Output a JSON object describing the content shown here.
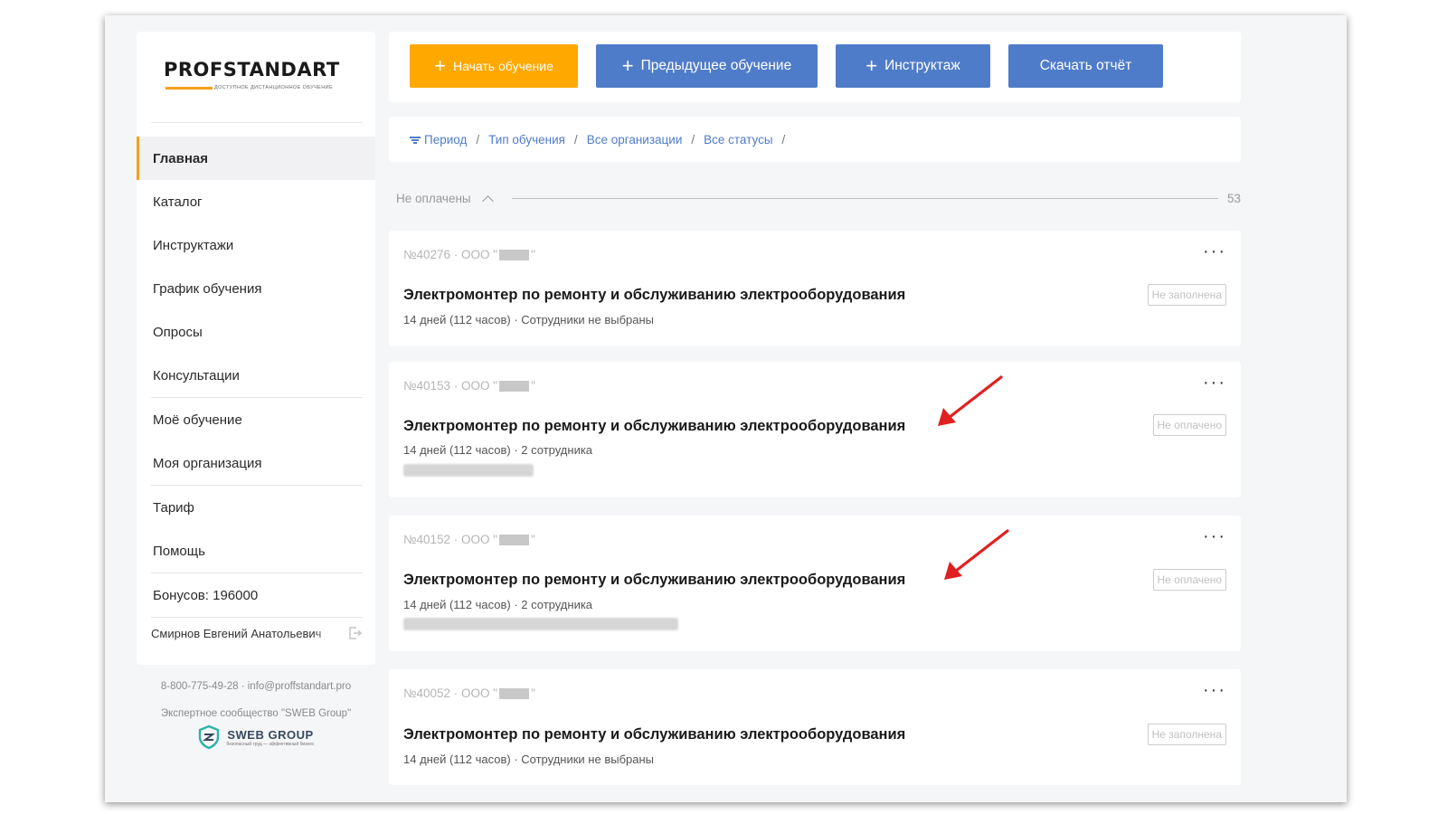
{
  "brand": {
    "name": "PROFSTANDART",
    "tagline": "доступное дистанционное обучение"
  },
  "colors": {
    "accent": "#ffa800",
    "primary": "#4f7cc9",
    "annotation": "#e02020"
  },
  "nav": {
    "items": [
      {
        "label": "Главная",
        "active": true
      },
      {
        "label": "Каталог"
      },
      {
        "label": "Инструктажи"
      },
      {
        "label": "График обучения"
      },
      {
        "label": "Опросы"
      },
      {
        "label": "Консультации"
      },
      {
        "label": "Моё обучение"
      },
      {
        "label": "Моя организация"
      },
      {
        "label": "Тариф"
      },
      {
        "label": "Помощь"
      },
      {
        "label": "Бонусов: 196000"
      }
    ]
  },
  "user": {
    "name": "Смирнов Евгений Анатольевич",
    "logout_icon": "logout-icon"
  },
  "contacts": {
    "line": "8-800-775-49-28 · info@proffstandart.pro",
    "community": "Экспертное сообщество \"SWEB Group\"",
    "partner_name": "SWEB GROUP",
    "partner_tagline": "безопасный труд — эффективный бизнес"
  },
  "toolbar": {
    "start": "Начать обучение",
    "previous": "Предыдущее обучение",
    "briefing": "Инструктаж",
    "report": "Скачать отчёт"
  },
  "filters": [
    "Период",
    "Тип обучения",
    "Все организации",
    "Все статусы"
  ],
  "group": {
    "label": "Не оплачены",
    "count": "53"
  },
  "cards": [
    {
      "number": "№40276 · ООО \"",
      "number_end": "\"",
      "title": "Электромонтер по ремонту и обслуживанию электрооборудования",
      "meta": "14 дней (112 часов) · Сотрудники не выбраны",
      "status": "Не заполнена"
    },
    {
      "number": "№40153 · ООО \"",
      "number_end": "\"",
      "title": "Электромонтер по ремонту и обслуживанию электрооборудования",
      "meta": "14 дней (112 часов) · 2 сотрудника",
      "status": "Не оплачено"
    },
    {
      "number": "№40152 · ООО \"",
      "number_end": "\"",
      "title": "Электромонтер по ремонту и обслуживанию электрооборудования",
      "meta": "14 дней (112 часов) · 2 сотрудника",
      "status": "Не оплачено"
    },
    {
      "number": "№40052 · ООО \"",
      "number_end": "\"",
      "title": "Электромонтер по ремонту и обслуживанию электрооборудования",
      "meta": "14 дней (112 часов) · Сотрудники не выбраны",
      "status": "Не заполнена"
    }
  ]
}
